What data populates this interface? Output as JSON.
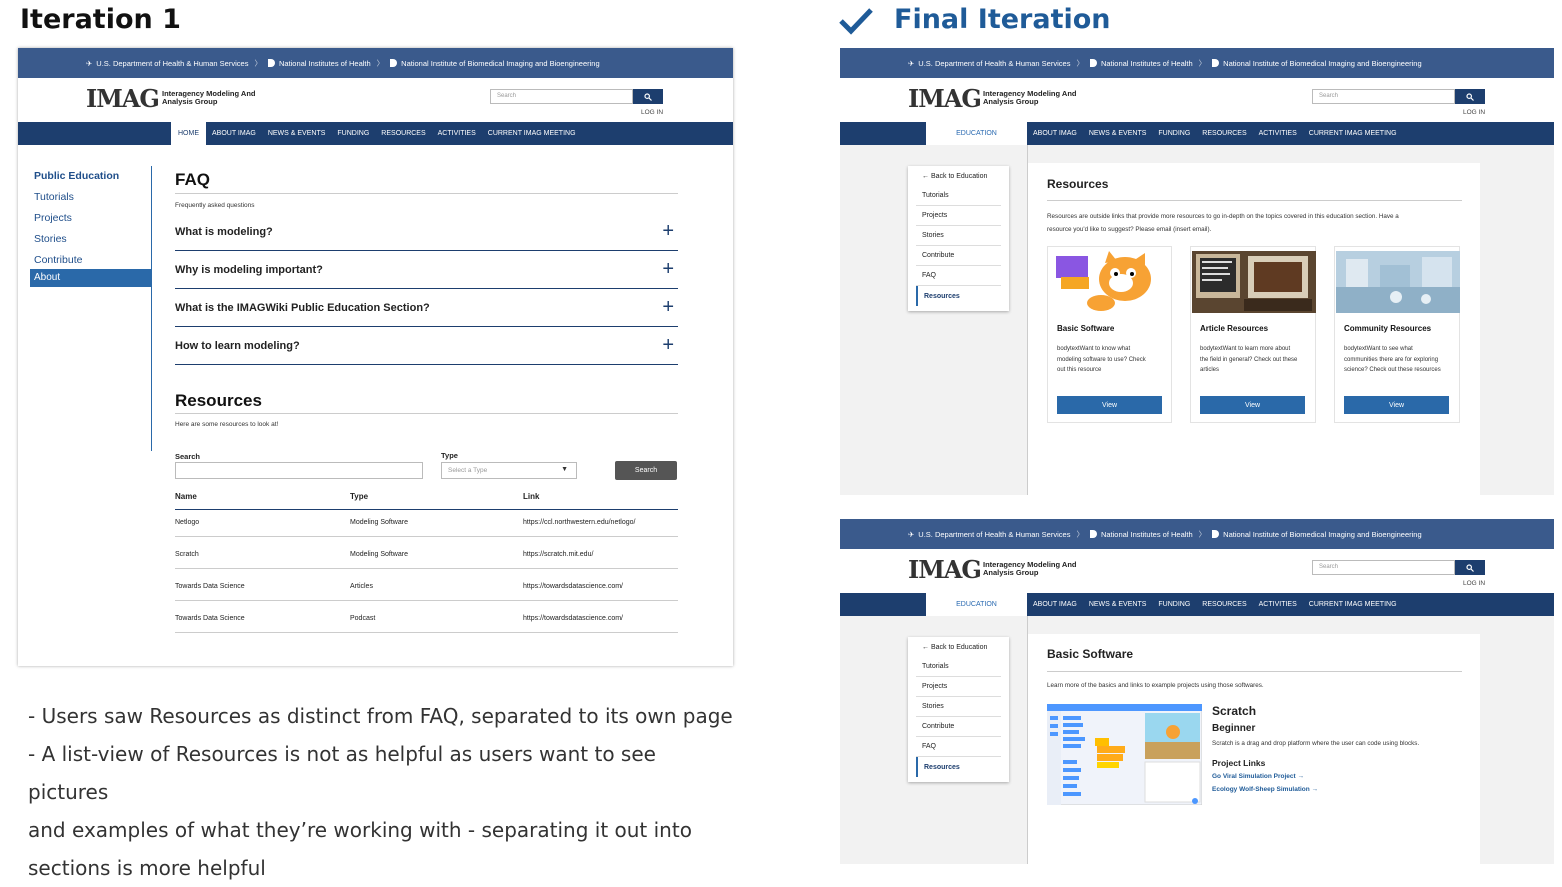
{
  "headings": {
    "iteration1": "Iteration 1",
    "final": "Final Iteration"
  },
  "topbar": {
    "hhs": "U.S. Department of Health & Human Services",
    "nih": "National Institutes of Health",
    "nibib": "National Institute of Biomedical Imaging and Bioengineering"
  },
  "header": {
    "logo": "IMAG",
    "logo_sub_1": "Interagency Modeling And",
    "logo_sub_2": "Analysis Group",
    "search_placeholder": "Search",
    "login": "LOG IN"
  },
  "nav": {
    "home": "HOME",
    "about": "ABOUT IMAG",
    "news": "NEWS & EVENTS",
    "funding": "FUNDING",
    "resources": "RESOURCES",
    "activities": "ACTIVITIES",
    "meeting": "CURRENT IMAG MEETING",
    "education": "EDUCATION"
  },
  "iter1": {
    "sidebar": [
      "Public Education",
      "Tutorials",
      "Projects",
      "Stories",
      "Contribute",
      "About"
    ],
    "faq_title": "FAQ",
    "faq_sub": "Frequently asked questions",
    "faq": [
      "What is modeling?",
      "Why is modeling important?",
      "What is the IMAGWiki Public Education Section?",
      "How to learn modeling?"
    ],
    "res_title": "Resources",
    "res_sub": "Here are some resources to look at!",
    "search_label": "Search",
    "type_label": "Type",
    "type_placeholder": "Select a Type",
    "search_btn": "Search",
    "cols": [
      "Name",
      "Type",
      "Link"
    ],
    "rows": [
      [
        "Netlogo",
        "Modeling Software",
        "https://ccl.northwestern.edu/netlogo/"
      ],
      [
        "Scratch",
        "Modeling Software",
        "https://scratch.mit.edu/"
      ],
      [
        "Towards Data Science",
        "Articles",
        "https://towardsdatascience.com/"
      ],
      [
        "Towards Data Science",
        "Podcast",
        "https://towardsdatascience.com/"
      ]
    ]
  },
  "final_side": {
    "back": "← Back to Education",
    "items": [
      "Tutorials",
      "Projects",
      "Stories",
      "Contribute",
      "FAQ",
      "Resources"
    ]
  },
  "final1": {
    "title": "Resources",
    "intro_1": "Resources are outside links that provide more resources to go in-depth on the topics covered in this education section. Have a",
    "intro_2": "resource you'd like to suggest? Please email (insert email).",
    "cards": [
      {
        "title": "Basic Software",
        "d1": "bodytextWant to know what",
        "d2": "modeling software to use? Check",
        "d3": "out this resource",
        "btn": "View"
      },
      {
        "title": "Article Resources",
        "d1": "bodytextWant to learn more about",
        "d2": "the field in general? Check out these",
        "d3": "articles",
        "btn": "View"
      },
      {
        "title": "Community Resources",
        "d1": "bodytextWant to see what",
        "d2": "communities there are for exploring",
        "d3": "science? Check out these resources",
        "btn": "View"
      }
    ]
  },
  "final2": {
    "title": "Basic Software",
    "intro": "Learn more of the basics and links to example projects using those softwares.",
    "name": "Scratch",
    "level": "Beginner",
    "desc": "Scratch is a drag and drop platform where the user can code using blocks.",
    "links_title": "Project Links",
    "link1": "Go Viral Simulation Project →",
    "link2": "Ecology Wolf-Sheep Simulation →"
  },
  "notes": [
    "- Users saw Resources as distinct from FAQ, separated to its own page",
    "- A list-view of Resources is not as helpful as users want to see pictures",
    "and examples of what they’re working with - separating it out into",
    "sections is more helpful"
  ],
  "colors": {
    "nav": "#1d3e6e",
    "topbar": "#3a5a8c",
    "accent": "#2a69a9"
  }
}
